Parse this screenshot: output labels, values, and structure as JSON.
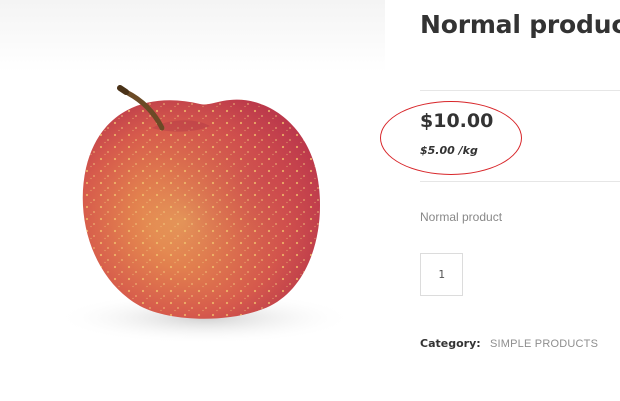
{
  "product": {
    "title": "Normal product",
    "price": "$10.00",
    "unit_price": "$5.00 /kg",
    "short_description": "Normal product",
    "quantity": "1",
    "category_label": "Category:",
    "category_value": "SIMPLE PRODUCTS",
    "image_subject": "apple-icon"
  },
  "colors": {
    "highlight": "#d8262a",
    "text": "#333333",
    "muted": "#888888"
  }
}
